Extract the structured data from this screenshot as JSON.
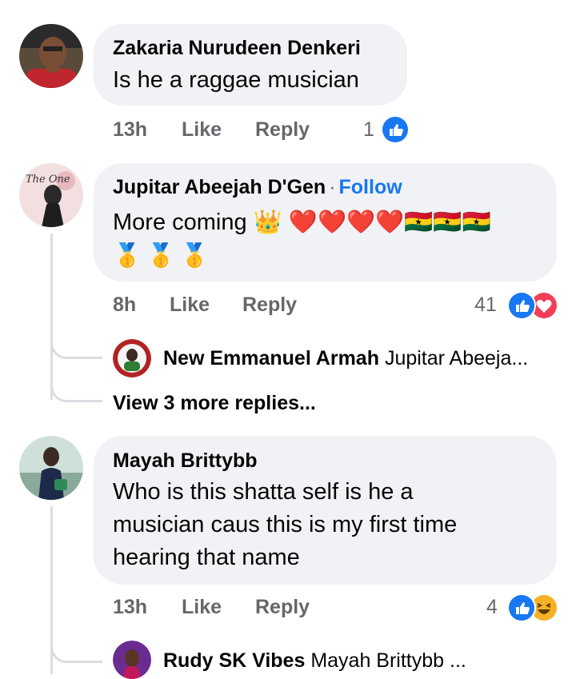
{
  "comments": [
    {
      "author": "Zakaria Nurudeen Denkeri",
      "text": "Is he a raggae musician",
      "time": "13h",
      "like_label": "Like",
      "reply_label": "Reply",
      "reaction_count": "1",
      "reactions": [
        "like-icon"
      ]
    },
    {
      "author": "Jupitar Abeejah  D'Gen",
      "separator": "·",
      "follow_label": "Follow",
      "text_line1": "More coming 👑 ❤️❤️❤️❤️🇬🇭🇬🇭🇬🇭",
      "text_line2": "🥇🥇🥇",
      "time": "8h",
      "like_label": "Like",
      "reply_label": "Reply",
      "reaction_count": "41",
      "reactions": [
        "like-icon",
        "love-icon"
      ],
      "reply_preview": {
        "author": "New Emmanuel Armah",
        "text": "Jupitar Abeeja..."
      },
      "view_more": "View 3 more replies..."
    },
    {
      "author": "Mayah Brittybb",
      "text_line1": "Who is this shatta self is he a",
      "text_line2": "musician caus this is my first time",
      "text_line3": "hearing that name",
      "time": "13h",
      "like_label": "Like",
      "reply_label": "Reply",
      "reaction_count": "4",
      "reactions": [
        "like-icon",
        "haha-icon"
      ],
      "reply_preview": {
        "author": "Rudy SK Vibes",
        "text": "Mayah Brittybb ..."
      }
    }
  ],
  "colors": {
    "bubble": "#f0f2f5",
    "meta_gray": "#65676b",
    "link_blue": "#1877f2",
    "like_blue": "#1877f2",
    "love_red": "#f33e58",
    "haha_yellow": "#f7b125"
  }
}
